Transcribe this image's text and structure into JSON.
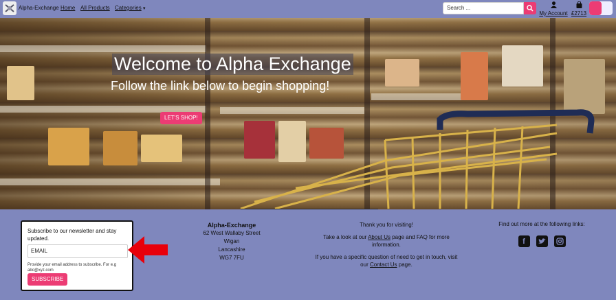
{
  "navbar": {
    "brand": "Alpha-Exchange",
    "links": [
      "Home",
      "All Products",
      "Categories"
    ],
    "search_placeholder": "Search ...",
    "account_label": "My Account",
    "basket_total": "£2713"
  },
  "hero": {
    "title": "Welcome to Alpha Exchange",
    "subtitle": "Follow the link below to begin shopping!",
    "button_label": "LET'S SHOP!"
  },
  "newsletter": {
    "text": "Subscribe to our newsletter and stay updated.",
    "email_placeholder": "EMAIL",
    "help_text": "Provide your email address to subscribe. For e.g abc@xyz.com",
    "button_label": "SUBSCRIBE"
  },
  "address": {
    "name": "Alpha-Exchange",
    "line1": "62 West Wallaby Street",
    "line2": "Wigan",
    "line3": "Lancashire",
    "postcode": "WG7 7FU"
  },
  "info": {
    "thanks": "Thank you for visiting!",
    "p2_before": "Take a look at our",
    "about_link": "About Us",
    "p2_after": "page and FAQ for more information.",
    "p3_before": "If you have a specific question of need to get in touch, visit our",
    "contact_link": "Contact Us",
    "p3_after": "page."
  },
  "social": {
    "heading": "Find out more at the following links:",
    "icons": [
      "facebook-icon",
      "twitter-icon",
      "instagram-icon"
    ]
  },
  "colors": {
    "brand_pink": "#ec3c74",
    "background": "#7f87bd",
    "arrow_red": "#e8000b"
  }
}
